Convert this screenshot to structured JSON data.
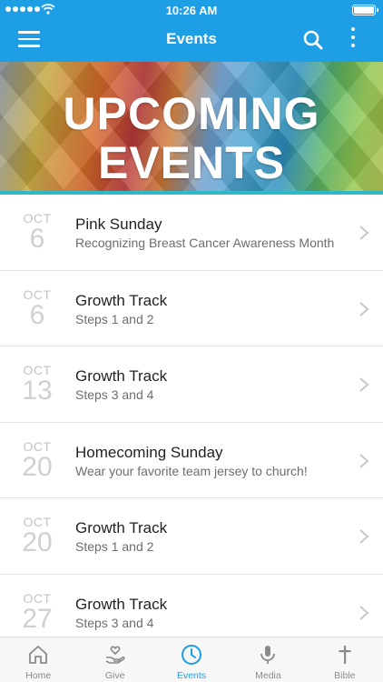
{
  "status_bar": {
    "time": "10:26 AM"
  },
  "nav": {
    "title": "Events"
  },
  "banner": {
    "line1": "UPCOMING",
    "line2": "EVENTS"
  },
  "events": [
    {
      "month": "OCT",
      "day": "6",
      "title": "Pink Sunday",
      "subtitle": "Recognizing Breast Cancer Awareness Month"
    },
    {
      "month": "OCT",
      "day": "6",
      "title": "Growth Track",
      "subtitle": "Steps 1 and 2"
    },
    {
      "month": "OCT",
      "day": "13",
      "title": "Growth Track",
      "subtitle": "Steps 3 and 4"
    },
    {
      "month": "OCT",
      "day": "20",
      "title": "Homecoming Sunday",
      "subtitle": "Wear your favorite team jersey to church!"
    },
    {
      "month": "OCT",
      "day": "20",
      "title": "Growth Track",
      "subtitle": "Steps 1 and 2"
    },
    {
      "month": "OCT",
      "day": "27",
      "title": "Growth Track",
      "subtitle": "Steps 3 and 4"
    }
  ],
  "tabs": [
    {
      "label": "Home",
      "icon": "home-icon"
    },
    {
      "label": "Give",
      "icon": "give-icon"
    },
    {
      "label": "Events",
      "icon": "clock-icon",
      "active": true
    },
    {
      "label": "Media",
      "icon": "microphone-icon"
    },
    {
      "label": "Bible",
      "icon": "cross-icon"
    }
  ],
  "colors": {
    "accent": "#1e9ee4",
    "inactive": "#8a8a8a",
    "divider": "#e2e2e2"
  }
}
